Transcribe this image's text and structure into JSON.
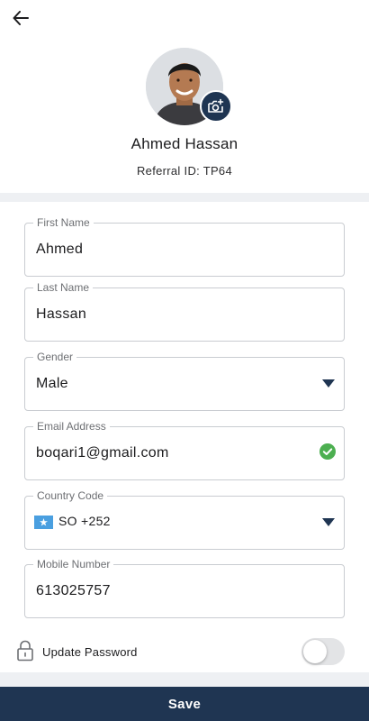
{
  "profile": {
    "name": "Ahmed Hassan",
    "referral": "Referral ID: TP64"
  },
  "fields": {
    "first_name": {
      "label": "First Name",
      "value": "Ahmed"
    },
    "last_name": {
      "label": "Last Name",
      "value": "Hassan"
    },
    "gender": {
      "label": "Gender",
      "value": "Male"
    },
    "email": {
      "label": "Email Address",
      "value": "boqari1@gmail.com"
    },
    "country_code": {
      "label": "Country Code",
      "value": "SO +252",
      "flag": "somalia-flag"
    },
    "mobile": {
      "label": "Mobile Number",
      "value": "613025757"
    }
  },
  "password": {
    "label": "Update Password",
    "enabled": false
  },
  "save": {
    "label": "Save"
  },
  "icons": {
    "back": "arrow-left-icon",
    "camera": "camera-add-icon",
    "dropdown": "caret-down-icon",
    "valid": "check-circle-icon",
    "lock": "lock-icon"
  },
  "colors": {
    "primary": "#1f3552",
    "valid": "#4caf50",
    "flag": "#4a9fe0"
  }
}
